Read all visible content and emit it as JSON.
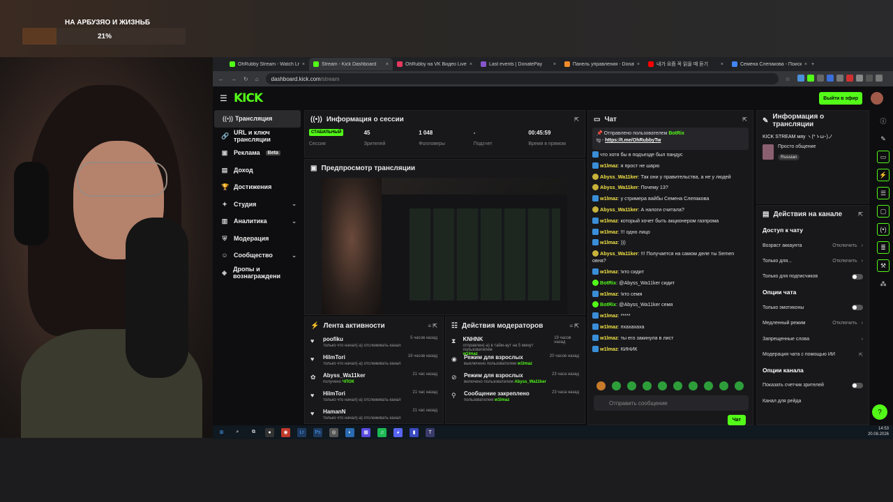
{
  "overlay": {
    "goal_title": "НА АРБУЗЯО И ЖИЗНЬБ",
    "goal_percent": "21%",
    "goal_progress": 0.21
  },
  "tabs": [
    {
      "label": "OhRubby Stream - Watch Live o",
      "color": "#53fc18"
    },
    {
      "label": "Stream - Kick Dashboard",
      "color": "#53fc18"
    },
    {
      "label": "OhRubby на VK Видео Live – с",
      "color": "#e63960"
    },
    {
      "label": "Last events | DonatePay",
      "color": "#8855cc"
    },
    {
      "label": "Панель управления - Donatio",
      "color": "#f28c28"
    },
    {
      "label": "내가 요즘 꼭 읽을 때 듣기",
      "color": "#ff0000"
    },
    {
      "label": "Семена Слепакова - Поиск в",
      "color": "#4285f4"
    }
  ],
  "address": {
    "host": "dashboard.kick.com",
    "path": "/stream"
  },
  "kick": {
    "logo": "KICK",
    "live_button": "Выйти в эфир"
  },
  "sidebar": [
    {
      "label": "Трансляция",
      "icon": "broadcast-icon"
    },
    {
      "label": "URL и ключ трансляции",
      "icon": "link-icon"
    },
    {
      "label": "Реклама",
      "icon": "ad-icon",
      "badge": "Beta"
    },
    {
      "label": "Доход",
      "icon": "income-icon"
    },
    {
      "label": "Достижения",
      "icon": "trophy-icon"
    },
    {
      "label": "Студия",
      "icon": "studio-icon",
      "expand": "⌄"
    },
    {
      "label": "Аналитика",
      "icon": "analytics-icon",
      "expand": "⌄"
    },
    {
      "label": "Модерация",
      "icon": "shield-icon"
    },
    {
      "label": "Сообщество",
      "icon": "community-icon",
      "expand": "⌄"
    },
    {
      "label": "Дропы и вознаграждени",
      "icon": "drops-icon"
    }
  ],
  "session": {
    "title": "Информация о сессии",
    "status": "СТАБИЛЬНЫЙ",
    "stats": [
      {
        "value": "45",
        "label": "Зрителей"
      },
      {
        "value": "1 048",
        "label": "Фолловеры"
      },
      {
        "value": "-",
        "label": "Подсчет"
      },
      {
        "value": "00:45:59",
        "label": "Время в прямом"
      }
    ],
    "session_label": "Сессия"
  },
  "preview": {
    "title": "Предпросмотр трансляции"
  },
  "activity": {
    "title": "Лента активности",
    "items": [
      {
        "name": "poofiku",
        "sub": "только что начал(-а) отслеживать канал",
        "time": "5 часов назад",
        "icon": "heart-icon"
      },
      {
        "name": "HilmTori",
        "sub": "только что начал(-а) отслеживать канал",
        "time": "18 часов назад",
        "icon": "heart-icon"
      },
      {
        "name": "Abyss_Wa11ker",
        "sub": "получено",
        "highlight": "ЧПОК",
        "time": "21 час назад",
        "icon": "gift-icon"
      },
      {
        "name": "HilmTori",
        "sub": "только что начал(-а) отслеживать канал",
        "time": "21 час назад",
        "icon": "heart-icon"
      },
      {
        "name": "HamanN",
        "sub": "только что начал(-а) отслеживать канал",
        "time": "21 час назад",
        "icon": "heart-icon"
      }
    ]
  },
  "modactions": {
    "title": "Действия модераторов",
    "items": [
      {
        "name": "KNHNK",
        "sub": "отправлен(-а) в тайм-аут на 5 минут пользователем",
        "by": "w1lmaz",
        "time": "19 часов назад",
        "icon": "hourglass-icon"
      },
      {
        "name": "Режим для взрослых",
        "sub": "выключено пользователем",
        "by": "w1lmaz",
        "time": "20 часов назад",
        "icon": "eye-icon"
      },
      {
        "name": "Режим для взрослых",
        "sub": "включено пользователем",
        "by": "Abyss_Wa11ker",
        "time": "23 часа назад",
        "icon": "eye-off-icon"
      },
      {
        "name": "Сообщение закреплено",
        "sub": "пользователем",
        "by": "w1lmaz",
        "time": "23 часа назад",
        "icon": "pin-icon"
      }
    ]
  },
  "chat": {
    "title": "Чат",
    "pinned_by": "Отправлено пользователем",
    "pinned_user": "BotRix",
    "pinned_text": "tg -",
    "pinned_link": "https://t.me/OhRubbyTw",
    "messages": [
      {
        "u": "",
        "t": "что хотя бы в подъезде был пандус",
        "b": "b",
        "c": ""
      },
      {
        "u": "w1lmaz",
        "t": ": я прост не шарю",
        "b": "b",
        "c": "n1"
      },
      {
        "u": "Abyss_Wa11ker",
        "t": ": Так они у правительства, а не у людей",
        "b": "y",
        "c": "n2"
      },
      {
        "u": "Abyss_Wa11ker",
        "t": ": Почему 13?",
        "b": "y",
        "c": "n2"
      },
      {
        "u": "w1lmaz",
        "t": ": у стримера вайбы Семена Слепакова",
        "b": "b",
        "c": "n1"
      },
      {
        "u": "Abyss_Wa11ker",
        "t": ": А налоги считала?",
        "b": "y",
        "c": "n2"
      },
      {
        "u": "w1lmaz",
        "t": ": который хочет быть акционером газпрома",
        "b": "b",
        "c": "n1"
      },
      {
        "u": "w1lmaz",
        "t": ": !!! одно лицо",
        "b": "b",
        "c": "n1"
      },
      {
        "u": "w1lmaz",
        "t": ": )))",
        "b": "b",
        "c": "n1"
      },
      {
        "u": "Abyss_Wa11ker",
        "t": ": !!! Получается на самом деле ты Semen овна?",
        "b": "y",
        "c": "n2"
      },
      {
        "u": "w1lmaz",
        "t": ": !кто сидит",
        "b": "b",
        "c": "n1"
      },
      {
        "u": "BotRix",
        "t": ": @Abyss_Wa11ker сидит",
        "b": "gr",
        "c": "n3"
      },
      {
        "u": "w1lmaz",
        "t": ": !кто семя",
        "b": "b",
        "c": "n1"
      },
      {
        "u": "BotRix",
        "t": ": @Abyss_Wa11ker семя",
        "b": "gr",
        "c": "n3"
      },
      {
        "u": "w1lmaz",
        "t": ": *****",
        "b": "b",
        "c": "n1"
      },
      {
        "u": "w1lmaz",
        "t": ": пхахахаха",
        "b": "b",
        "c": "n1"
      },
      {
        "u": "w1lmaz",
        "t": ": ты его закинула в лист",
        "b": "b",
        "c": "n1"
      },
      {
        "u": "w1lmaz",
        "t": ": КИНИК",
        "b": "b",
        "c": "n1"
      }
    ],
    "placeholder": "Отправить сообщение",
    "send": "Чат"
  },
  "stream_info": {
    "title": "Информация о трансляции",
    "stream_title": "KICK STREAM мяу ヽ(*ゝω･)ノ",
    "category": "Просто общение",
    "language": "Russian"
  },
  "channel": {
    "title": "Действия на канале",
    "sections": [
      {
        "head": "Доступ к чату",
        "rows": [
          {
            "label": "Возраст аккаунта",
            "value": "Отключить",
            "ctrl": "chev"
          },
          {
            "label": "Только для...",
            "value": "Отключить",
            "ctrl": "chev"
          },
          {
            "label": "Только для подписчиков",
            "value": "",
            "ctrl": "toggle"
          }
        ]
      },
      {
        "head": "Опции чата",
        "rows": [
          {
            "label": "Только эмотиконы",
            "value": "",
            "ctrl": "toggle"
          },
          {
            "label": "Медленный режим",
            "value": "Отключить",
            "ctrl": "chev"
          },
          {
            "label": "Запрещенные слова",
            "value": "",
            "ctrl": "chev"
          },
          {
            "label": "Модерация чата с помощью ИИ",
            "value": "",
            "ctrl": "ext"
          }
        ]
      },
      {
        "head": "Опции канала",
        "rows": [
          {
            "label": "Показать счетчик зрителей",
            "value": "",
            "ctrl": "toggle"
          },
          {
            "label": "Канал для рейда",
            "value": "",
            "ctrl": "none"
          }
        ]
      }
    ]
  },
  "taskbar": {
    "time": "14:53",
    "date": "20.08.2026"
  }
}
